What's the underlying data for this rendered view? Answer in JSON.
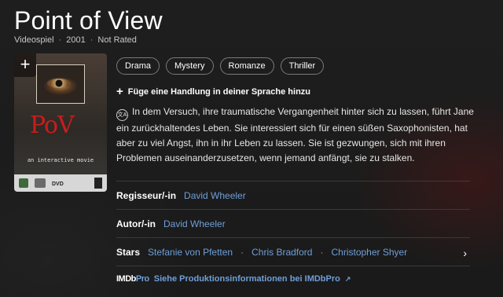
{
  "title": "Point of View",
  "meta": {
    "type": "Videospiel",
    "year": "2001",
    "rating": "Not Rated"
  },
  "poster": {
    "add_glyph": "+",
    "title_text": "PoV",
    "subtitle_text": "an interactive movie",
    "dvd_text": "DVD"
  },
  "genres": [
    "Drama",
    "Mystery",
    "Romanze",
    "Thriller"
  ],
  "add_plot_label": "Füge eine Handlung in deiner Sprache hinzu",
  "translate_icon": "文A",
  "plot": "In dem Versuch, ihre traumatische Vergangenheit hinter sich zu lassen, führt Jane ein zurückhaltendes Leben. Sie interessiert sich für einen süßen Saxophonisten, hat aber zu viel Angst, ihn in ihr Leben zu lassen. Sie ist gezwungen, sich mit ihren Problemen auseinanderzusetzen, wenn jemand anfängt, sie zu stalken.",
  "credits": {
    "director": {
      "label": "Regisseur/-in",
      "names": [
        "David Wheeler"
      ]
    },
    "writer": {
      "label": "Autor/-in",
      "names": [
        "David Wheeler"
      ]
    },
    "stars": {
      "label": "Stars",
      "names": [
        "Stefanie von Pfetten",
        "Chris Bradford",
        "Christopher Shyer"
      ]
    }
  },
  "imdbpro": {
    "logo_imdb": "IMDb",
    "logo_pro": "Pro",
    "link": "Siehe Produktionsinformationen bei IMDbPro"
  },
  "colors": {
    "link": "#6f9ed8",
    "background": "#1c1c1c"
  }
}
